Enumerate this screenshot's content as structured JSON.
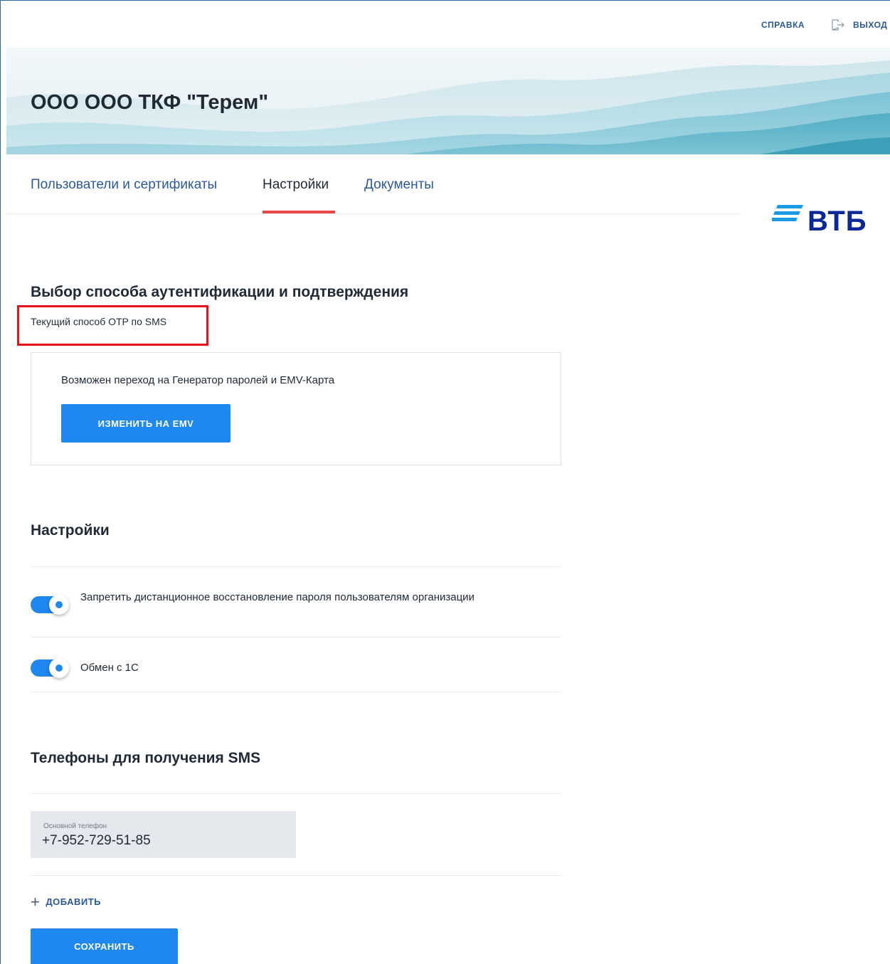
{
  "header": {
    "help_label": "СПРАВКА",
    "logout_label": "ВЫХОД",
    "organization_name": "ООО ООО ТКФ \"Терем\""
  },
  "tabs": [
    {
      "label": "Пользователи и сертификаты",
      "active": false
    },
    {
      "label": "Настройки",
      "active": true
    },
    {
      "label": "Документы",
      "active": false
    }
  ],
  "logo": {
    "text": "ВТБ"
  },
  "auth_section": {
    "title": "Выбор способа аутентификации и подтверждения",
    "current_method": "Текущий способ OTP по SMS",
    "switch_info": "Возможен переход на Генератор паролей и EMV-Карта",
    "change_button_label": "ИЗМЕНИТЬ НА EMV"
  },
  "settings_section": {
    "title": "Настройки",
    "toggles": [
      {
        "label": "Запретить дистанционное восстановление пароля пользователям организации",
        "enabled": true
      },
      {
        "label": "Обмен с 1С",
        "enabled": true
      }
    ]
  },
  "phones_section": {
    "title": "Телефоны для получения SMS",
    "primary_phone_caption": "Основной телефон",
    "primary_phone_value": "+7-952-729-51-85",
    "add_label": "ДОБАВИТЬ"
  },
  "save_button_label": "СОХРАНИТЬ",
  "colors": {
    "accent_blue": "#1e88f0",
    "link_blue": "#2a5a9c",
    "active_tab_underline": "#e94848",
    "highlight_red": "#e8131a",
    "brand_navy": "#0a2896"
  }
}
